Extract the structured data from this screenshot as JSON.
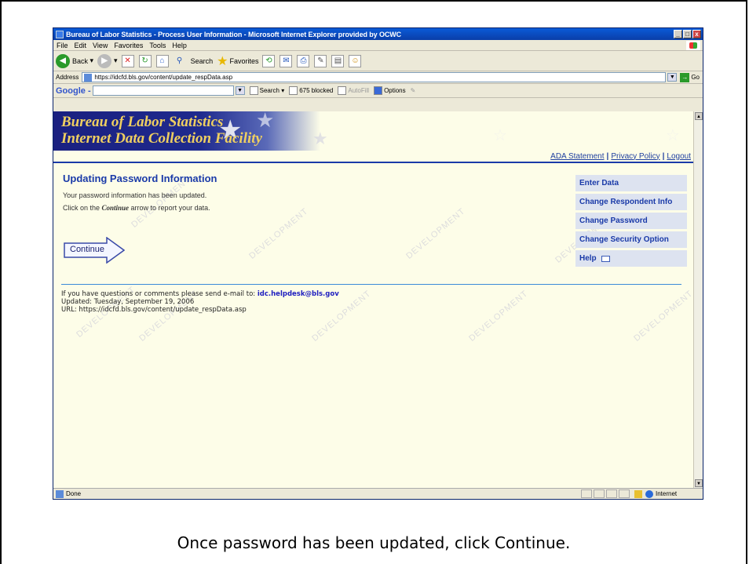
{
  "window": {
    "title": "Bureau of Labor Statistics - Process User Information - Microsoft Internet Explorer provided by OCWC",
    "min": "_",
    "max": "□",
    "close": "x"
  },
  "menu": [
    "File",
    "Edit",
    "View",
    "Favorites",
    "Tools",
    "Help"
  ],
  "toolbar": {
    "back": "Back",
    "search": "Search",
    "favorites": "Favorites"
  },
  "address": {
    "label": "Address",
    "url": "https://idcfd.bls.gov/content/update_respData.asp",
    "go": "Go"
  },
  "google": {
    "logo": "Google -",
    "search": "Search",
    "blocked": "675 blocked",
    "autofill": "AutoFill",
    "options": "Options"
  },
  "banner": {
    "line1": "Bureau of Labor Statistics",
    "line2": "Internet Data Collection Facility"
  },
  "toplinks": [
    "ADA Statement",
    "Privacy Policy",
    "Logout"
  ],
  "watermark": "DEVELOPMENT",
  "page": {
    "heading": "Updating Password Information",
    "msg1": "Your password information has been updated.",
    "msg2_pre": "Click on the ",
    "msg2_em": "Continue",
    "msg2_post": " arrow to report your data.",
    "continue": "Continue"
  },
  "sidenav": [
    "Enter Data",
    "Change Respondent Info",
    "Change Password",
    "Change Security Option",
    "Help"
  ],
  "footer": {
    "line1_pre": "If you have questions or comments please send e-mail to: ",
    "email": "idc.helpdesk@bls.gov",
    "line2": "Updated: Tuesday, September 19, 2006",
    "line3": "URL: https://idcfd.bls.gov/content/update_respData.asp"
  },
  "status": {
    "text": "Done",
    "zone": "Internet"
  },
  "caption": "Once password has been updated, click Continue."
}
